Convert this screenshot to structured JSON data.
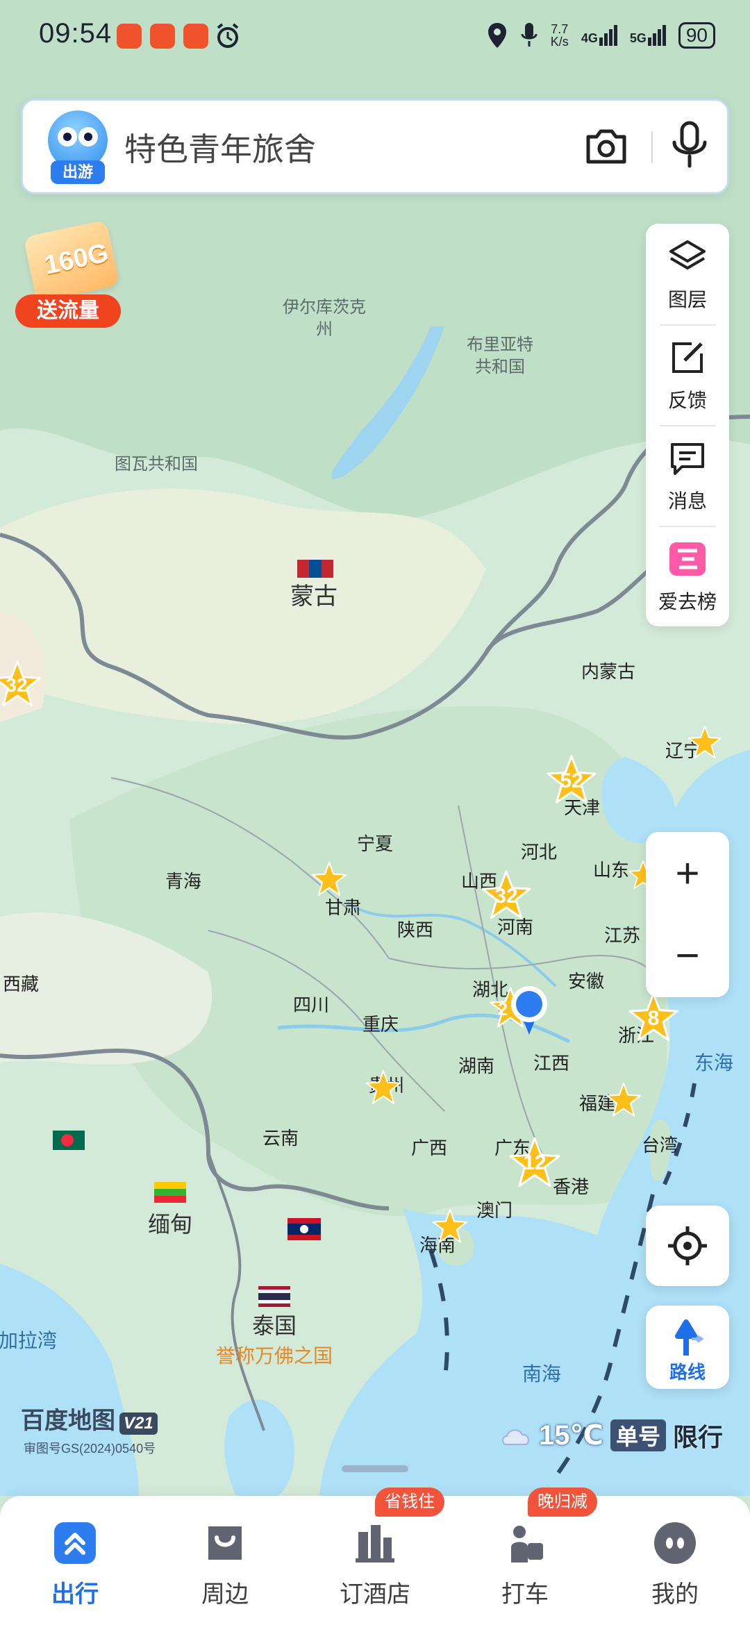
{
  "status_bar": {
    "time": "09:54",
    "net_speed_value": "7.7",
    "net_speed_unit": "K/s",
    "network_4g": "4G",
    "network_5g": "5G",
    "battery": "90"
  },
  "search": {
    "mascot_tag": "出游",
    "placeholder": "特色青年旅舍",
    "camera_icon": "camera-icon",
    "mic_icon": "microphone-icon"
  },
  "promo": {
    "card_text": "160G",
    "pill_label": "送流量"
  },
  "tools": [
    {
      "icon": "layers-icon",
      "label": "图层"
    },
    {
      "icon": "feedback-edit-icon",
      "label": "反馈"
    },
    {
      "icon": "message-icon",
      "label": "消息"
    },
    {
      "icon": "ranking-icon",
      "label": "爱去榜"
    }
  ],
  "zoom": {
    "in": "+",
    "out": "−"
  },
  "route": {
    "label": "路线"
  },
  "map": {
    "labels": {
      "irkutsk": "伊尔库茨克",
      "irkutsk_2": "州",
      "buryatia": "布里亚特",
      "buryatia_2": "共和国",
      "tuva": "图瓦共和国",
      "mongolia": "蒙古",
      "inner_mongolia": "内蒙古",
      "tianjin": "天津",
      "liaoning": "辽宁",
      "hebei": "河北",
      "ningxia": "宁夏",
      "shanxi": "山西",
      "shandong": "山东",
      "qinghai": "青海",
      "gansu": "甘肃",
      "henan": "河南",
      "shaanxi": "陕西",
      "jiangsu": "江苏",
      "tibet": "西藏",
      "hubei": "湖北",
      "anhui": "安徽",
      "sichuan": "四川",
      "chongqing": "重庆",
      "zhejiang": "浙江",
      "east_sea": "东海",
      "hunan": "湖南",
      "jiangxi": "江西",
      "guizhou": "贵州",
      "fujian": "福建",
      "yunnan": "云南",
      "guangxi": "广西",
      "guangdong": "广东",
      "taiwan": "台湾",
      "hong_kong": "香港",
      "macau": "澳门",
      "hainan": "海南",
      "myanmar": "缅甸",
      "thailand": "泰国",
      "thailand_sub": "誉称万佛之国",
      "bay_of_bengal": "加拉湾",
      "south_sea": "南海"
    },
    "stars": {
      "s1": "32",
      "s2": "52",
      "s3": "32",
      "s4": "2",
      "s5": "8",
      "s6": "12"
    }
  },
  "branding": {
    "name": "百度地图",
    "version": "V21",
    "approval": "审图号GS(2024)0540号"
  },
  "weather": {
    "temperature": "15℃",
    "plate_rule": "单号",
    "limit": "限行"
  },
  "bottom_nav": [
    {
      "icon": "travel-icon",
      "label": "出行",
      "active": true
    },
    {
      "icon": "nearby-icon",
      "label": "周边",
      "active": false
    },
    {
      "icon": "hotel-icon",
      "label": "订酒店",
      "active": false,
      "badge": "省钱住"
    },
    {
      "icon": "taxi-icon",
      "label": "打车",
      "active": false,
      "badge": "晚归减"
    },
    {
      "icon": "profile-icon",
      "label": "我的",
      "active": false
    }
  ],
  "colors": {
    "accent": "#1f6fe8",
    "badge": "#f2533b",
    "star": "#ffbf1a",
    "water": "#aee0f7",
    "land": "#cfe6d6"
  }
}
